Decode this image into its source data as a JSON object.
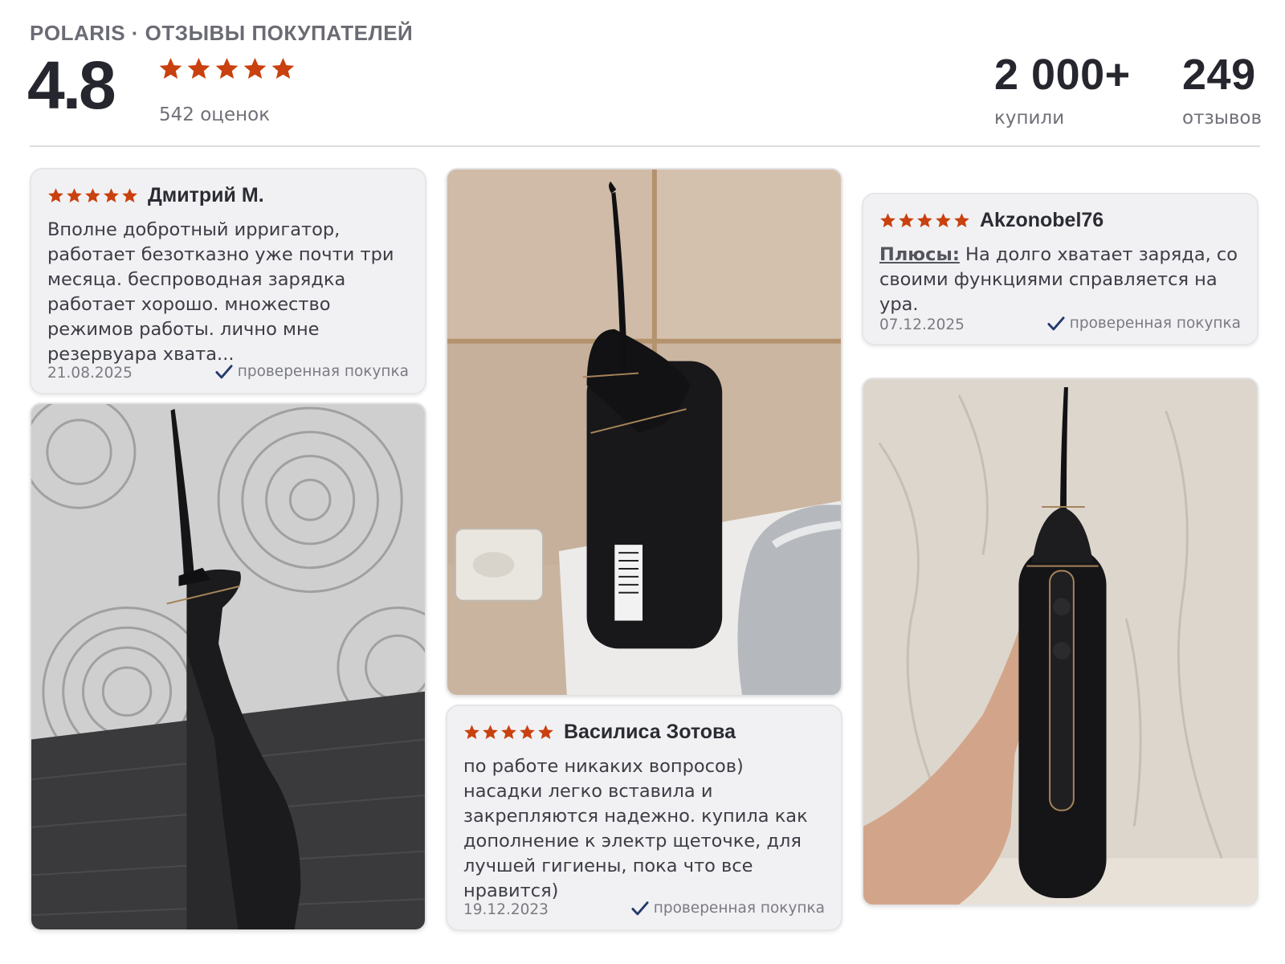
{
  "header": {
    "brand": "POLARIS · ОТЗЫВЫ ПОКУПАТЕЛЕЙ",
    "rating": "4.8",
    "ratings_count": "542 оценок",
    "star_color": "#c9410f",
    "stats": [
      {
        "value": "2 000+",
        "label": "купили"
      },
      {
        "value": "249",
        "label": "отзывов"
      }
    ]
  },
  "reviews": [
    {
      "author": "Дмитрий М.",
      "stars": 5,
      "text": "Вполне добротный ирригатор, работает безотказно уже почти три месяца. беспроводная зарядка работает хорошо. множество режимов работы. лично мне резервуара хвата...",
      "date": "21.08.2025",
      "verified": "проверенная покупка"
    },
    {
      "author": "Akzonobel76",
      "stars": 5,
      "pros_label": "Плюсы:",
      "text": " На долго хватает заряда, со своими функциями справляется на ура.",
      "date": "07.12.2025",
      "verified": "проверенная покупка"
    },
    {
      "author": "Василиса Зотова",
      "stars": 5,
      "text": "по работе никаких вопросов) насадки легко вставила и закрепляются надежно. купила как дополнение к электр щеточке, для лучшей гигиены, пока что все нравится)",
      "date": "19.12.2023",
      "verified": "проверенная покупка"
    }
  ],
  "photos": [
    {
      "subject": "irrigator-on-dark-table"
    },
    {
      "subject": "irrigator-on-bathroom-sink"
    },
    {
      "subject": "irrigator-in-hand"
    }
  ]
}
